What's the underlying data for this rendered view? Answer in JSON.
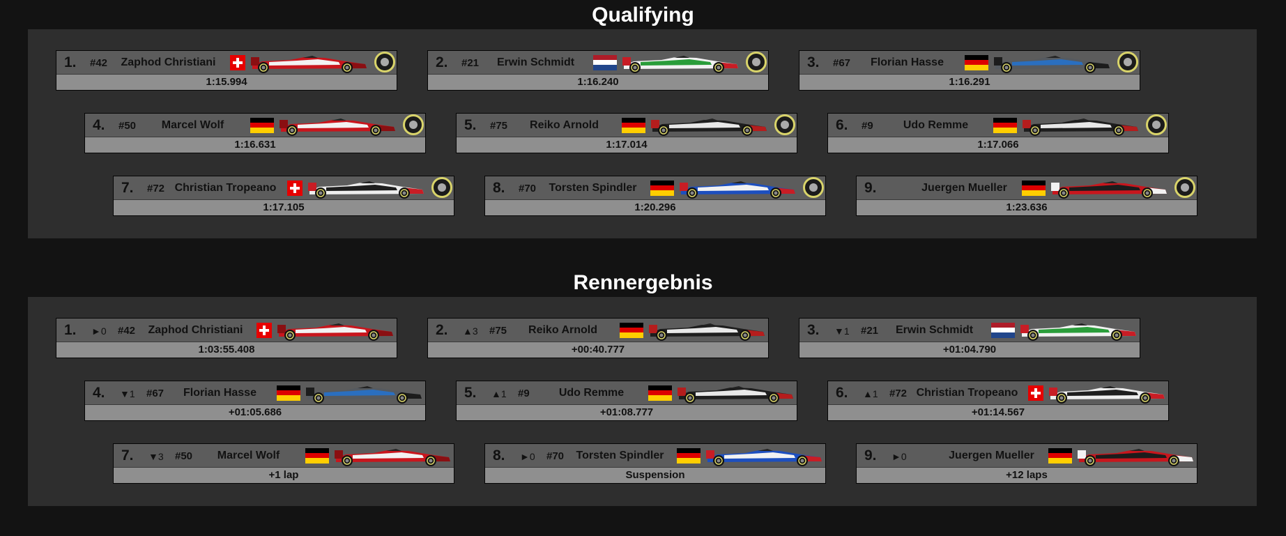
{
  "qualifying": {
    "title": "Qualifying",
    "entries": [
      {
        "pos": "1.",
        "number": "#42",
        "name": "Zaphod Christiani",
        "flag": "CH",
        "car": "red-white",
        "tyre": "pirelli-soft",
        "result": "1:15.994"
      },
      {
        "pos": "2.",
        "number": "#21",
        "name": "Erwin Schmidt",
        "flag": "NL",
        "car": "white-green",
        "tyre": "pirelli-soft",
        "result": "1:16.240"
      },
      {
        "pos": "3.",
        "number": "#67",
        "name": "Florian Hasse",
        "flag": "DE",
        "car": "grey-blue",
        "tyre": "pirelli-soft",
        "result": "1:16.291"
      },
      {
        "pos": "4.",
        "number": "#50",
        "name": "Marcel Wolf",
        "flag": "DE",
        "car": "red-white",
        "tyre": "pirelli-soft",
        "result": "1:16.631"
      },
      {
        "pos": "5.",
        "number": "#75",
        "name": "Reiko Arnold",
        "flag": "DE",
        "car": "black-white",
        "tyre": "pirelli-soft",
        "result": "1:17.014"
      },
      {
        "pos": "6.",
        "number": "#9",
        "name": "Udo Remme",
        "flag": "DE",
        "car": "black-white",
        "tyre": "pirelli-soft",
        "result": "1:17.066"
      },
      {
        "pos": "7.",
        "number": "#72",
        "name": "Christian Tropeano",
        "flag": "CH",
        "car": "white-black-red",
        "tyre": "pirelli-soft",
        "result": "1:17.105"
      },
      {
        "pos": "8.",
        "number": "#70",
        "name": "Torsten Spindler",
        "flag": "DE",
        "car": "blue-white",
        "tyre": "pirelli-soft",
        "result": "1:20.296"
      },
      {
        "pos": "9.",
        "number": "",
        "name": "Juergen Mueller",
        "flag": "DE",
        "car": "red-black",
        "tyre": "pirelli-soft",
        "result": "1:23.636"
      }
    ]
  },
  "race": {
    "title": "Rennergebnis",
    "entries": [
      {
        "pos": "1.",
        "change": "►0",
        "number": "#42",
        "name": "Zaphod Christiani",
        "flag": "CH",
        "car": "red-white",
        "result": "1:03:55.408"
      },
      {
        "pos": "2.",
        "change": "▲3",
        "number": "#75",
        "name": "Reiko Arnold",
        "flag": "DE",
        "car": "black-white",
        "result": "+00:40.777"
      },
      {
        "pos": "3.",
        "change": "▼1",
        "number": "#21",
        "name": "Erwin Schmidt",
        "flag": "NL",
        "car": "white-green",
        "result": "+01:04.790"
      },
      {
        "pos": "4.",
        "change": "▼1",
        "number": "#67",
        "name": "Florian Hasse",
        "flag": "DE",
        "car": "grey-blue",
        "result": "+01:05.686"
      },
      {
        "pos": "5.",
        "change": "▲1",
        "number": "#9",
        "name": "Udo Remme",
        "flag": "DE",
        "car": "black-white",
        "result": "+01:08.777"
      },
      {
        "pos": "6.",
        "change": "▲1",
        "number": "#72",
        "name": "Christian Tropeano",
        "flag": "CH",
        "car": "white-black-red",
        "result": "+01:14.567"
      },
      {
        "pos": "7.",
        "change": "▼3",
        "number": "#50",
        "name": "Marcel Wolf",
        "flag": "DE",
        "car": "red-white",
        "result": "+1 lap"
      },
      {
        "pos": "8.",
        "change": "►0",
        "number": "#70",
        "name": "Torsten Spindler",
        "flag": "DE",
        "car": "blue-white",
        "result": "Suspension"
      },
      {
        "pos": "9.",
        "change": "►0",
        "number": "",
        "name": "Juergen Mueller",
        "flag": "DE",
        "car": "red-black",
        "result": "+12 laps"
      }
    ]
  },
  "colors": {
    "background": "#131313",
    "panel": "#2e2e2e",
    "card_top": "#5c5c5c",
    "card_bottom": "#8f8f8f",
    "title": "#ffffff"
  }
}
